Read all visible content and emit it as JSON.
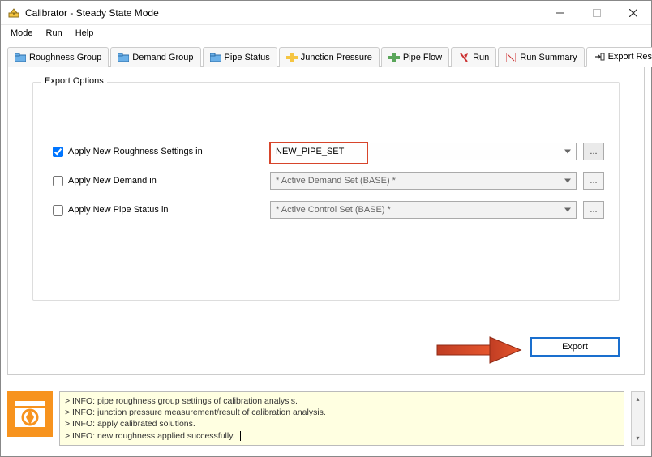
{
  "window": {
    "title": "Calibrator - Steady State Mode"
  },
  "menu": {
    "mode": "Mode",
    "run": "Run",
    "help": "Help"
  },
  "tabs": {
    "roughness": "Roughness Group",
    "demand": "Demand Group",
    "pipe_status": "Pipe Status",
    "junction_pressure": "Junction Pressure",
    "pipe_flow": "Pipe Flow",
    "run": "Run",
    "run_summary": "Run Summary",
    "export_results": "Export Results"
  },
  "export": {
    "group_title": "Export Options",
    "rows": {
      "roughness": {
        "label": "Apply New Roughness Settings in",
        "value": "NEW_PIPE_SET",
        "checked": true,
        "enabled": true
      },
      "demand": {
        "label": "Apply New Demand in",
        "value": "* Active Demand Set (BASE) *",
        "checked": false,
        "enabled": false
      },
      "pipe_status": {
        "label": "Apply New Pipe Status in",
        "value": "* Active Control Set (BASE) *",
        "checked": false,
        "enabled": false
      }
    },
    "ellipsis": "...",
    "export_button": "Export"
  },
  "log": {
    "lines": [
      "> INFO: pipe roughness group settings of calibration analysis.",
      "> INFO: junction pressure measurement/result of calibration analysis.",
      "> INFO: apply calibrated solutions.",
      "> INFO: new roughness applied successfully."
    ]
  },
  "colors": {
    "accent_orange": "#f7931e",
    "highlight_red": "#d7452b",
    "export_border": "#1a6fce",
    "log_bg": "#ffffe1"
  }
}
